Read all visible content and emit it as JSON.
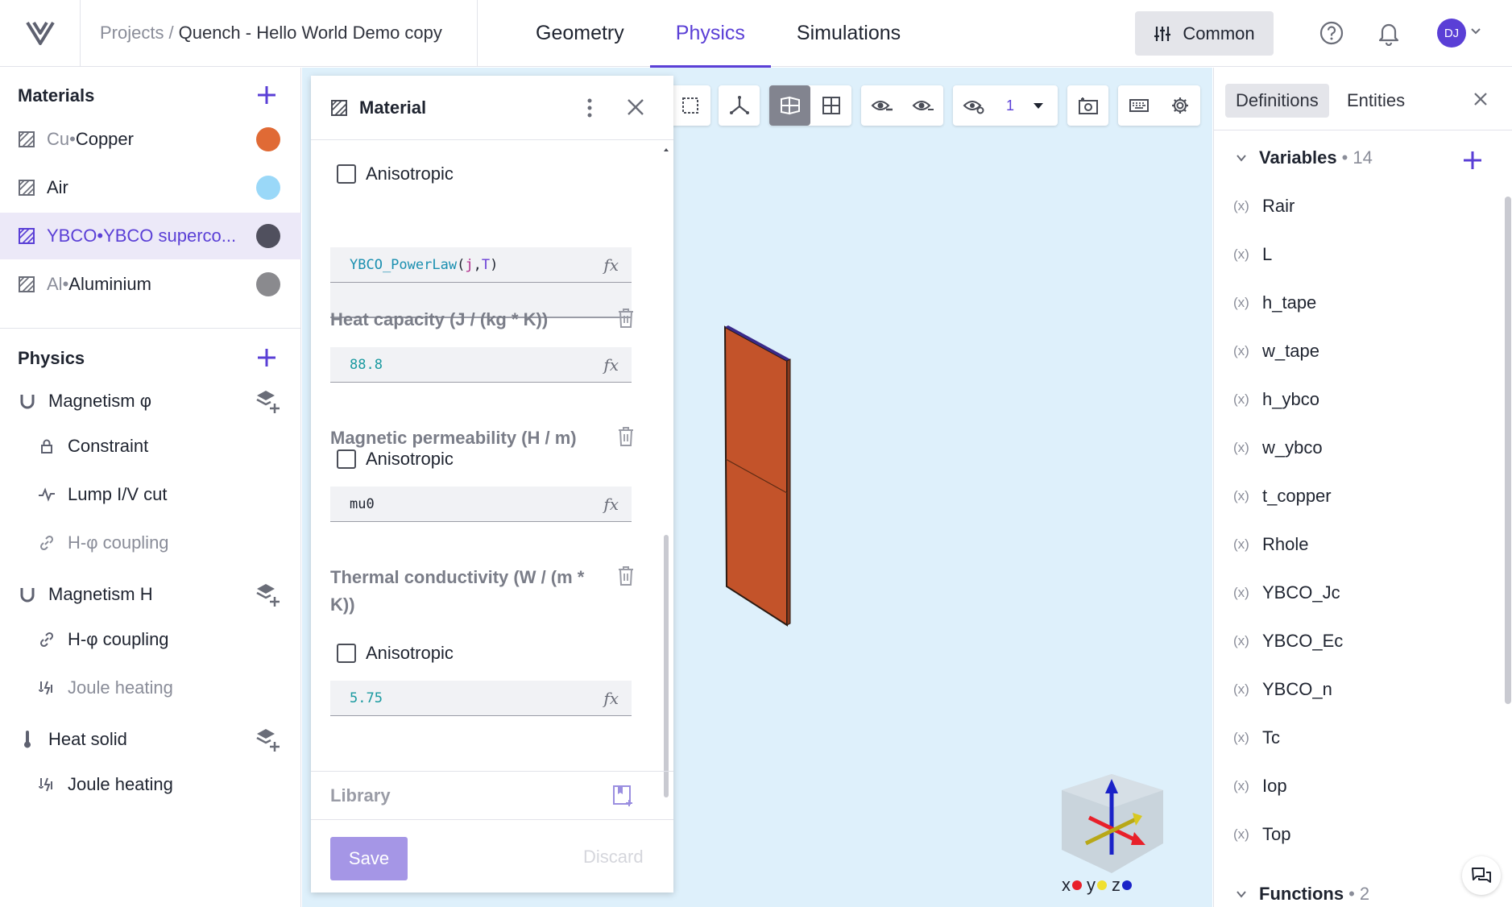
{
  "header": {
    "breadcrumb_root": "Projects",
    "breadcrumb_sep": "/",
    "project_name": "Quench - Hello World Demo copy",
    "tabs": [
      "Geometry",
      "Physics",
      "Simulations"
    ],
    "active_tab": "Physics",
    "common_label": "Common",
    "avatar_initials": "DJ"
  },
  "sidebar": {
    "materials_title": "Materials",
    "materials": [
      {
        "id": "Cu",
        "sep": " • ",
        "name": "Copper",
        "color": "#e06a35"
      },
      {
        "id": "Air",
        "sep": "",
        "name": "",
        "color": "#9ad8f8"
      },
      {
        "id": "YBCO",
        "sep": " • ",
        "name": "YBCO superco...",
        "color": "#50505e"
      },
      {
        "id": "Al",
        "sep": " • ",
        "name": "Aluminium",
        "color": "#8a8a8e"
      }
    ],
    "physics_title": "Physics",
    "physics": [
      {
        "label": "Magnetism φ",
        "icon": "magnet-icon"
      },
      {
        "label": "Constraint",
        "icon": "lock-icon"
      },
      {
        "label": "Lump I/V cut",
        "icon": "pulse-icon"
      },
      {
        "label": "H-φ coupling",
        "icon": "link-icon"
      },
      {
        "label": "Magnetism H",
        "icon": "magnet-icon"
      },
      {
        "label": "H-φ coupling",
        "icon": "link-icon"
      },
      {
        "label": "Joule heating",
        "icon": "joule-icon"
      },
      {
        "label": "Heat solid",
        "icon": "thermometer-icon"
      },
      {
        "label": "Joule heating",
        "icon": "joule-icon"
      }
    ]
  },
  "material_panel": {
    "title": "Material",
    "anisotropic_label": "Anisotropic",
    "resistivity_expr_name": "YBCO_PowerLaw",
    "resistivity_expr_open": "(",
    "resistivity_expr_j": "j",
    "resistivity_expr_comma": ",",
    "resistivity_expr_T": "T",
    "resistivity_expr_close": ")",
    "heat_capacity_label": "Heat capacity (J / (kg * K))",
    "heat_capacity_value": "88.8",
    "permeability_label": "Magnetic permeability (H / m)",
    "permeability_value": "mu0",
    "conductivity_label": "Thermal conductivity (W / (m * K))",
    "conductivity_value": "5.75",
    "library_label": "Library",
    "save_label": "Save",
    "discard_label": "Discard",
    "fx_label": "fx"
  },
  "viewport": {
    "view_count": "1",
    "axes": [
      "x",
      "y",
      "z"
    ],
    "axis_colors": [
      "#e8202a",
      "#f0e030",
      "#1a22c8"
    ],
    "background": "#def0fb"
  },
  "right_panel": {
    "tabs": [
      "Definitions",
      "Entities"
    ],
    "active_tab": "Definitions",
    "variables_title": "Variables",
    "variables_count": "14",
    "variables": [
      "Rair",
      "L",
      "h_tape",
      "w_tape",
      "h_ybco",
      "w_ybco",
      "t_copper",
      "Rhole",
      "YBCO_Jc",
      "YBCO_Ec",
      "YBCO_n",
      "Tc",
      "Iop",
      "Top"
    ],
    "functions_title": "Functions",
    "functions_count": "2",
    "count_sep": "•"
  },
  "colors": {
    "accent": "#5a3fd6",
    "selected_row": "#ece9f8"
  }
}
